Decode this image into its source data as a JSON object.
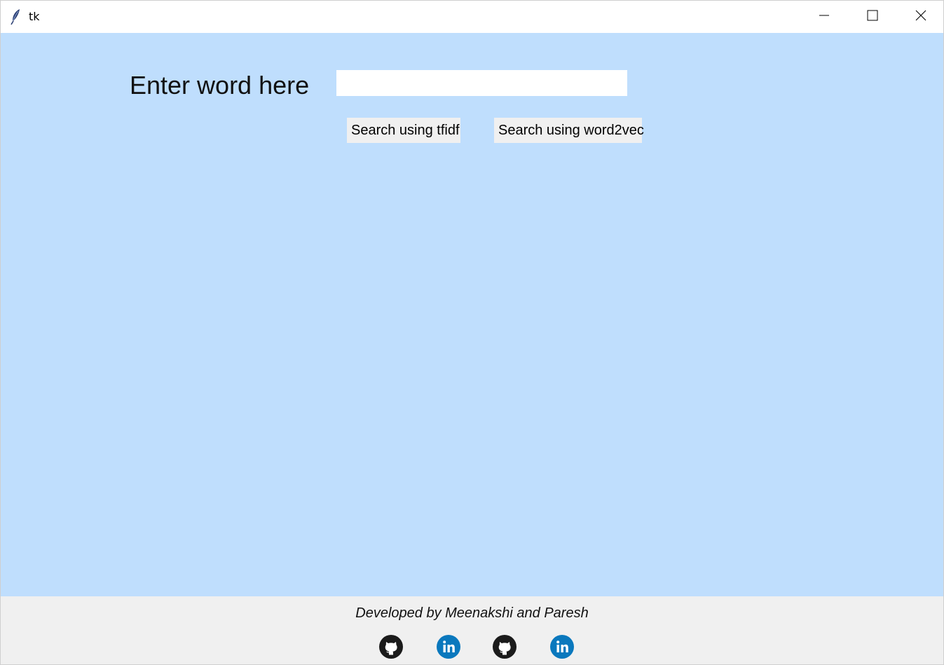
{
  "window": {
    "title": "tk"
  },
  "form": {
    "label": "Enter word here",
    "input_value": "",
    "input_placeholder": ""
  },
  "buttons": {
    "tfidf_label": "Search using tfidf",
    "word2vec_label": "Search using word2vec"
  },
  "footer": {
    "credit": "Developed by Meenakshi and Paresh",
    "links": [
      {
        "icon": "github-icon"
      },
      {
        "icon": "linkedin-icon"
      },
      {
        "icon": "github-icon"
      },
      {
        "icon": "linkedin-icon"
      }
    ]
  },
  "colors": {
    "main_background": "#bfdefd",
    "footer_background": "#f0f0f0",
    "button_background": "#f0f0f0",
    "linkedin_blue": "#0a78bd",
    "github_dark": "#1b1b1b"
  }
}
